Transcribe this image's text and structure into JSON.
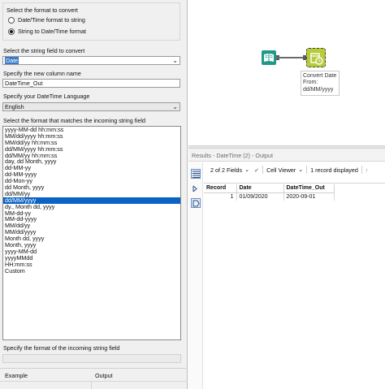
{
  "config": {
    "format_group_title": "Select the format to convert",
    "radio_options": [
      {
        "label": "Date/Time format to string",
        "selected": false
      },
      {
        "label": "String to Date/Time format",
        "selected": true
      }
    ],
    "field_label": "Select the string field to convert",
    "field_value": "Date",
    "new_column_label": "Specify the new column name",
    "new_column_value": "DateTime_Out",
    "language_label": "Specify your DateTime Language",
    "language_value": "English",
    "format_list_label": "Select the format that matches the incoming string field",
    "format_list": [
      "yyyy-MM-dd hh:mm:ss",
      "MM/dd/yyyy hh:mm:ss",
      "MM/dd/yy hh:mm:ss",
      "dd/MM/yyyy hh:mm:ss",
      "dd/MM/yy hh:mm:ss",
      "day, dd Month, yyyy",
      "dd-MM-yy",
      "dd-MM-yyyy",
      "dd-Mon-yy",
      "dd Month, yyyy",
      "dd/MM/yy",
      "dd/MM/yyyy",
      "dy., Month dd, yyyy",
      "MM-dd-yy",
      "MM-dd-yyyy",
      "MM/dd/yy",
      "MM/dd/yyyy",
      "Month dd, yyyy",
      "Month, yyyy",
      "yyyy-MM-dd",
      "yyyyMMdd",
      "HH:mm:ss",
      "Custom"
    ],
    "selected_format_index": 11,
    "incoming_format_label": "Specify the format of the incoming string field",
    "incoming_format_value": "",
    "grid_headers": [
      "Example",
      "Output"
    ]
  },
  "canvas": {
    "annotation_lines": [
      "Convert Date",
      "From:",
      "dd/MM/yyyy"
    ],
    "input_tool_color": "#1f9a8a",
    "datetime_tool_color": "#b7cb3b"
  },
  "results": {
    "title": "Results - DateTime (2) - Output",
    "fields_label": "2 of 2 Fields",
    "viewer_label": "Cell Viewer",
    "records_label": "1 record displayed",
    "columns": [
      "Record",
      "Date",
      "DateTime_Out"
    ],
    "rows": [
      [
        "1",
        "01/09/2020",
        "2020-09-01"
      ]
    ]
  },
  "colors": {
    "selection": "#0b63c5",
    "accent": "#3b78c6"
  }
}
